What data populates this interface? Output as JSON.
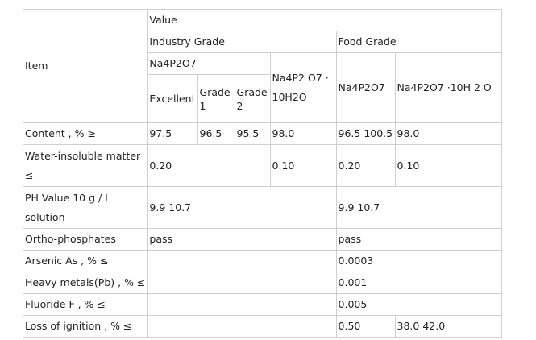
{
  "table": {
    "header": {
      "item": "Item",
      "value": "Value",
      "industry_grade": "Industry Grade",
      "food_grade": "Food Grade",
      "industry_na4p2o7": "Na4P2O7",
      "industry_decahydrate": "Na4P2 O7 · 10H2O",
      "excellent": "Excellent",
      "grade_1": "Grade 1",
      "grade_2": "Grade 2",
      "food_na4p2o7": "Na4P2O7",
      "food_decahydrate": "Na4P2O7 ·10H 2 O"
    },
    "rows": {
      "content": {
        "item": "Content , % ≥",
        "excellent": "97.5",
        "grade_1": "96.5",
        "grade_2": "95.5",
        "industry_decahydrate": "98.0",
        "food_na4p2o7": "96.5 100.5",
        "food_decahydrate": "98.0"
      },
      "water_insoluble": {
        "item": "Water-insoluble matter ≤",
        "industry_na4p2o7": "0.20",
        "industry_decahydrate": "0.10",
        "food_na4p2o7": "0.20",
        "food_decahydrate": "0.10"
      },
      "ph_value": {
        "item": "PH Value 10 g / L solution",
        "industry": "9.9 10.7",
        "food": "9.9 10.7"
      },
      "ortho_phosphates": {
        "item": "Ortho-phosphates",
        "industry": "pass",
        "food": "pass"
      },
      "arsenic": {
        "item": "Arsenic As , % ≤",
        "food": "0.0003"
      },
      "heavy_metals": {
        "item": "Heavy metals(Pb) , % ≤",
        "food": "0.001"
      },
      "fluoride": {
        "item": "Fluoride F , % ≤",
        "food": "0.005"
      },
      "loss_of_ignition": {
        "item": "Loss of ignition , % ≤",
        "food_na4p2o7": "0.50",
        "food_decahydrate": "38.0 42.0"
      }
    }
  }
}
